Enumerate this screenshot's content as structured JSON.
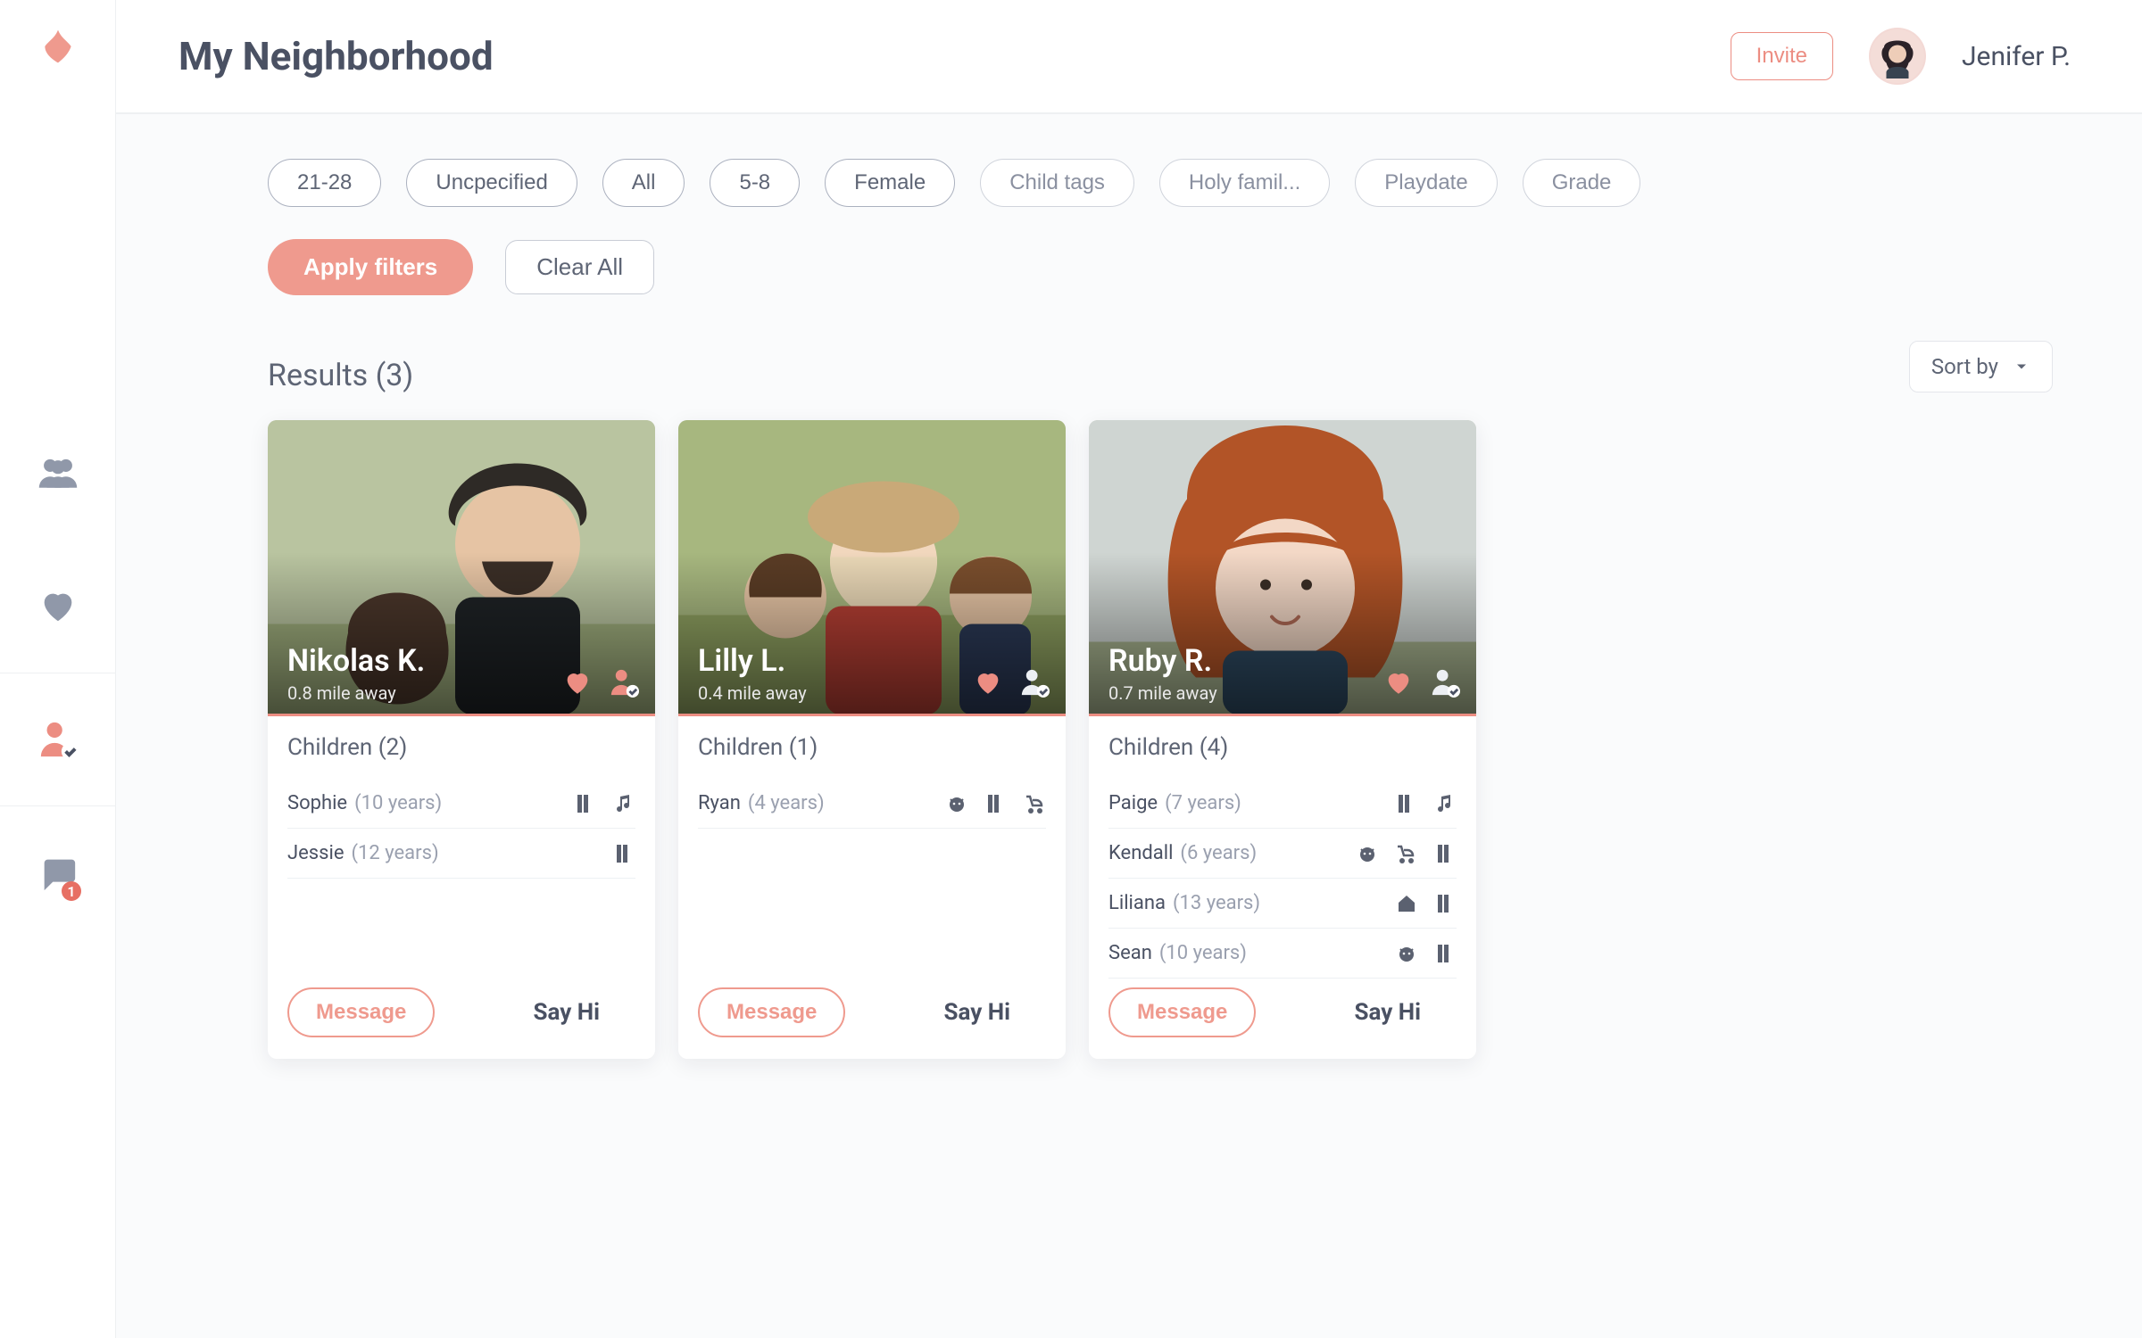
{
  "header": {
    "title": "My Neighborhood",
    "invite": "Invite",
    "username": "Jenifer P."
  },
  "sidebar": {
    "items": [
      "group",
      "heart",
      "person-check",
      "chat"
    ],
    "active_index": 2,
    "chat_badge": "1"
  },
  "filters": {
    "chips": [
      "21-28",
      "Uncpecified",
      "All",
      "5-8",
      "Female",
      "Child tags",
      "Holy famil...",
      "Playdate",
      "Grade"
    ],
    "apply": "Apply filters",
    "clear": "Clear All"
  },
  "results": {
    "label": "Results (3)",
    "sort_label": "Sort by"
  },
  "people": [
    {
      "name": "Nikolas K.",
      "distance": "0.8 mile away",
      "children_heading": "Children (2)",
      "children": [
        {
          "name": "Sophie",
          "age": "(10 years)",
          "icons": [
            "book",
            "music"
          ]
        },
        {
          "name": "Jessie",
          "age": "(12 years)",
          "icons": [
            "book"
          ]
        }
      ],
      "message": "Message",
      "sayhi": "Say Hi"
    },
    {
      "name": "Lilly L.",
      "distance": "0.4 mile away",
      "children_heading": "Children (1)",
      "children": [
        {
          "name": "Ryan",
          "age": "(4 years)",
          "icons": [
            "pig",
            "book",
            "stroller"
          ]
        }
      ],
      "message": "Message",
      "sayhi": "Say Hi"
    },
    {
      "name": "Ruby R.",
      "distance": "0.7 mile away",
      "children_heading": "Children (4)",
      "children": [
        {
          "name": "Paige",
          "age": "(7 years)",
          "icons": [
            "book",
            "music"
          ]
        },
        {
          "name": "Kendall",
          "age": "(6 years)",
          "icons": [
            "pig",
            "stroller",
            "book"
          ]
        },
        {
          "name": "Liliana",
          "age": "(13 years)",
          "icons": [
            "home",
            "book"
          ]
        },
        {
          "name": "Sean",
          "age": "(10 years)",
          "icons": [
            "pig",
            "book"
          ]
        }
      ],
      "message": "Message",
      "sayhi": "Say Hi"
    }
  ]
}
